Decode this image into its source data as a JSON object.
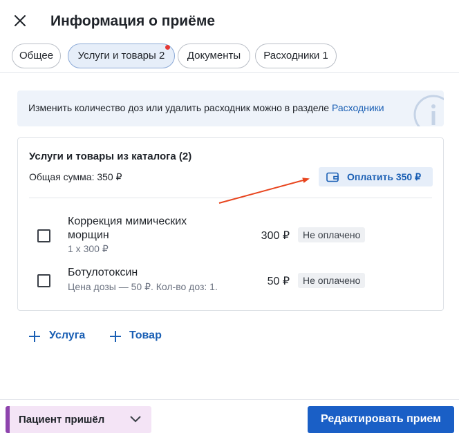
{
  "header": {
    "title": "Информация о приёме",
    "close_icon": "close-icon"
  },
  "tabs": [
    {
      "label": "Общее",
      "active": false
    },
    {
      "label": "Услуги и товары 2",
      "active": true,
      "has_notification_dot": true
    },
    {
      "label": "Документы",
      "active": false
    },
    {
      "label": "Расходники 1",
      "active": false
    }
  ],
  "info": {
    "text": "Изменить количество доз или удалить расходник можно в разделе",
    "link": "Расходники",
    "icon": "info-icon"
  },
  "catalog": {
    "title": "Услуги и товары из каталога (2)",
    "total": "Общая сумма: 350 ₽",
    "pay_button": "Оплатить 350 ₽",
    "pay_icon": "wallet-icon",
    "items": [
      {
        "name": "Коррекция мимических морщин",
        "sub": "1 x 300 ₽",
        "price": "300 ₽",
        "status": "Не оплачено"
      },
      {
        "name": "Ботулотоксин",
        "sub": "Цена дозы — 50 ₽. Кол-во доз: 1.",
        "price": "50 ₽",
        "status": "Не оплачено"
      }
    ]
  },
  "actions": {
    "add_service": "Услуга",
    "add_product": "Товар"
  },
  "footer": {
    "patient_status": "Пациент пришёл",
    "edit_button": "Редактировать прием"
  },
  "colors": {
    "accent": "#1a5fc6",
    "link": "#1a5fb4",
    "active_tab_bg": "#e6eef9",
    "notification_dot": "#e53935",
    "patient_status_bg": "#f4e4f6",
    "patient_status_bar": "#8e44ad",
    "annotation_arrow": "#e8451e"
  }
}
